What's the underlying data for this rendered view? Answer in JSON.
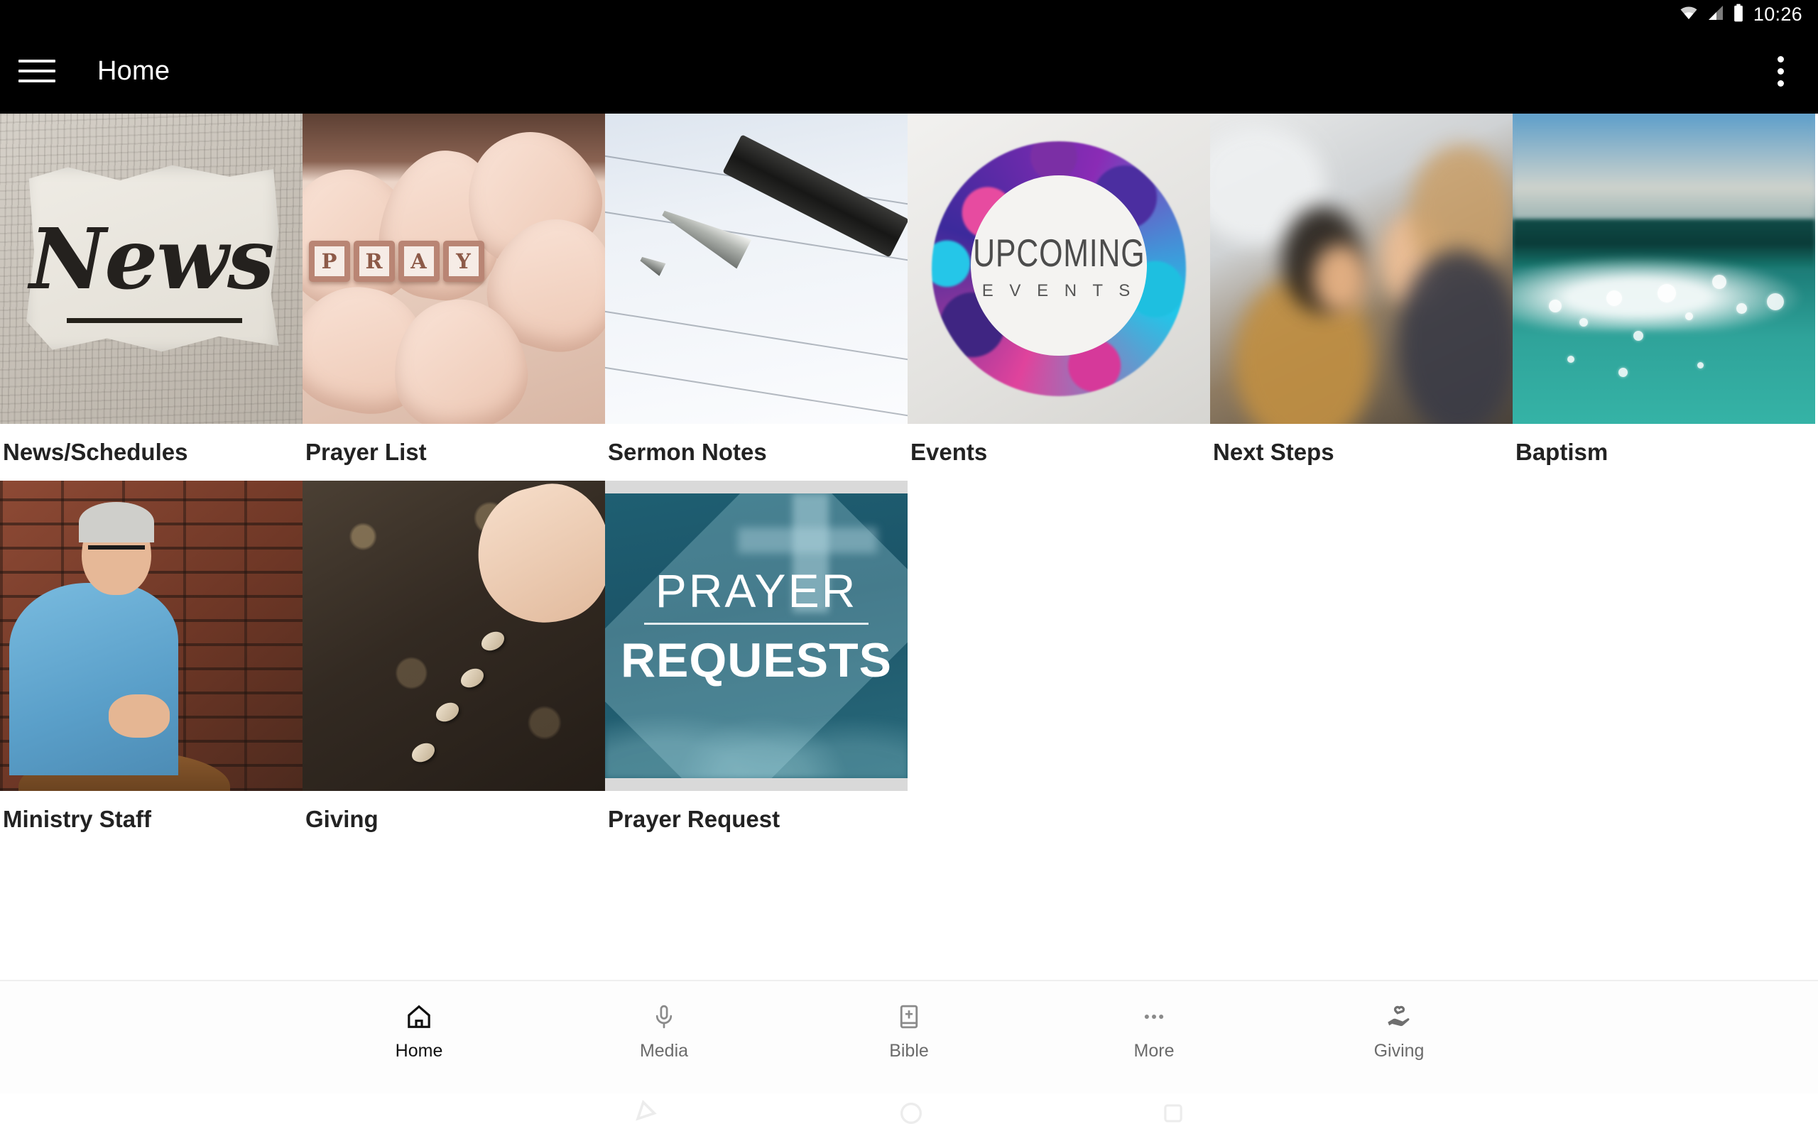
{
  "status_bar": {
    "time": "10:26",
    "icons": [
      "wifi-icon",
      "cellular-signal-icon",
      "battery-icon"
    ]
  },
  "app_bar": {
    "menu_icon": "hamburger-menu-icon",
    "title": "Home",
    "overflow_icon": "more-vertical-icon"
  },
  "colors": {
    "app_bar_background": "#000000",
    "page_background": "#ffffff",
    "caption_text": "#222222",
    "nav_active_text": "#101010",
    "nav_inactive_text": "#6b6b6b"
  },
  "grid": {
    "rows": [
      {
        "tiles": [
          {
            "label": "News/Schedules",
            "art": "news-torn-paper-image",
            "art_text": "News"
          },
          {
            "label": "Prayer List",
            "art": "hands-holding-pray-blocks-image",
            "art_text": "PRAY"
          },
          {
            "label": "Sermon Notes",
            "art": "pen-on-lined-paper-image",
            "art_text": ""
          },
          {
            "label": "Events",
            "art": "upcoming-events-paint-splatter-image",
            "art_text": "UPCOMING EVENTS"
          },
          {
            "label": "Next Steps",
            "art": "laughing-friends-photo",
            "art_text": ""
          },
          {
            "label": "Baptism",
            "art": "ocean-water-surface-photo",
            "art_text": ""
          }
        ]
      },
      {
        "tiles": [
          {
            "label": "Ministry Staff",
            "art": "pastor-portrait-brick-wall-photo",
            "art_text": ""
          },
          {
            "label": "Giving",
            "art": "hand-planting-seeds-in-soil-photo",
            "art_text": ""
          },
          {
            "label": "Prayer Request",
            "art": "prayer-requests-banner-image",
            "art_text": "PRAYER REQUESTS"
          }
        ]
      }
    ],
    "events_art": {
      "line1": "UPCOMING",
      "line2": "E V E N T S"
    },
    "prayer_request_art": {
      "line1": "PRAYER",
      "line2": "REQUESTS"
    },
    "pray_blocks": [
      "P",
      "R",
      "A",
      "Y"
    ],
    "news_art_word": "News"
  },
  "bottom_nav": {
    "items": [
      {
        "label": "Home",
        "icon": "home-icon",
        "active": true
      },
      {
        "label": "Media",
        "icon": "microphone-icon",
        "active": false
      },
      {
        "label": "Bible",
        "icon": "bible-book-icon",
        "active": false
      },
      {
        "label": "More",
        "icon": "more-horizontal-icon",
        "active": false
      },
      {
        "label": "Giving",
        "icon": "hand-heart-icon",
        "active": false
      }
    ]
  },
  "system_nav": {
    "back_icon": "back-triangle-icon",
    "home_icon": "home-circle-icon",
    "recents_icon": "recents-square-icon"
  }
}
